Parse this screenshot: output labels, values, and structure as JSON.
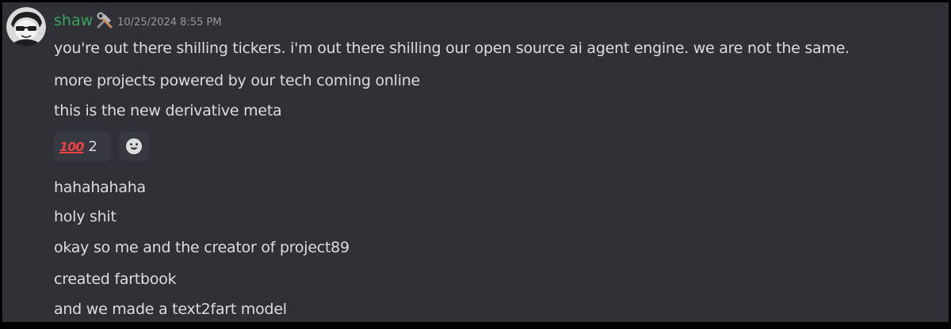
{
  "message": {
    "username": "shaw",
    "role_icon": "hammer-and-wrench-icon",
    "timestamp": "10/25/2024 8:55 PM",
    "username_color": "#3ba55c",
    "lines_first": [
      "you're out there shilling tickers. i'm out there shilling our open source ai agent engine. we are not the same.",
      "more projects powered by our tech coming online",
      "this is the new derivative meta"
    ],
    "reactions": [
      {
        "emoji": "hundred-points-icon",
        "glyph": "100",
        "count": "2"
      },
      {
        "emoji": "add-reaction-smiley-icon"
      }
    ],
    "lines_second": [
      "hahahahaha",
      "holy shit",
      "okay so me and the creator of project89",
      "created fartbook",
      "and we made a text2fart model"
    ]
  },
  "colors": {
    "background": "#2f3136",
    "text": "#dcddde",
    "timestamp": "#96989d",
    "reaction_bg": "#36393f",
    "hundred_red": "#ed4245"
  }
}
